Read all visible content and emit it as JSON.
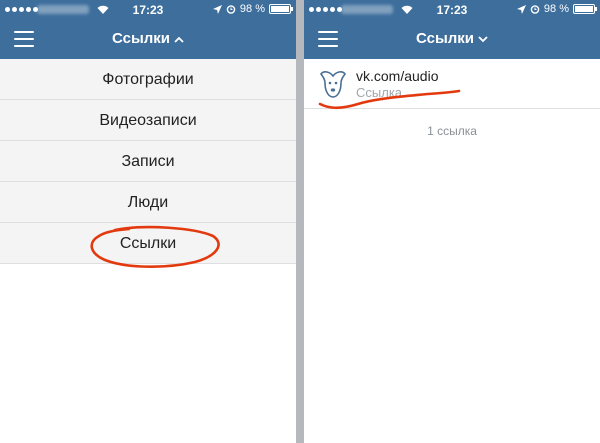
{
  "left": {
    "status": {
      "time": "17:23",
      "battery": "98 %",
      "battery_level": 0.98
    },
    "nav": {
      "title": "Ссылки",
      "menu_icon": "hamburger-icon",
      "chevron": "chevron-up-icon"
    },
    "menu": [
      {
        "label": "Фотографии"
      },
      {
        "label": "Видеозаписи"
      },
      {
        "label": "Записи"
      },
      {
        "label": "Люди"
      },
      {
        "label": "Ссылки"
      }
    ]
  },
  "right": {
    "status": {
      "time": "17:23",
      "battery": "98 %",
      "battery_level": 0.98
    },
    "nav": {
      "title": "Ссылки",
      "menu_icon": "hamburger-icon",
      "chevron": "chevron-down-icon"
    },
    "link": {
      "url": "vk.com/audio",
      "subtitle": "Ссылка",
      "icon": "vk-dog-icon"
    },
    "count": "1 ссылка"
  },
  "colors": {
    "accent": "#3d6e9c",
    "annotation": "#e23a0e",
    "subtle": "#a2a7ad"
  }
}
